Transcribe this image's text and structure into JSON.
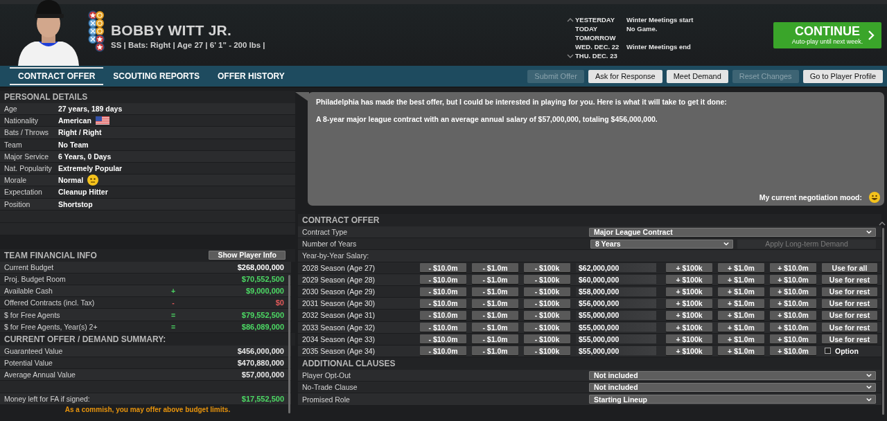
{
  "player": {
    "name": "BOBBY WITT JR.",
    "info": "SS | Bats: Right | Age 27 | 6' 1\"  - 200 lbs |"
  },
  "calendar": [
    {
      "day": "YESTERDAY",
      "event": "Winter Meetings start"
    },
    {
      "day": "TODAY",
      "event": "No Game."
    },
    {
      "day": "TOMORROW"
    },
    {
      "day": "WED. DEC. 22",
      "event": "Winter Meetings end"
    },
    {
      "day": "THU. DEC. 23"
    }
  ],
  "continue_button": {
    "label": "CONTINUE",
    "sublabel": "Auto-play until next week."
  },
  "tabs": [
    {
      "label": "CONTRACT OFFER",
      "selected": true
    },
    {
      "label": "SCOUTING REPORTS",
      "selected": false
    },
    {
      "label": "OFFER HISTORY",
      "selected": false
    }
  ],
  "actions": [
    {
      "label": "Submit Offer",
      "disabled": true
    },
    {
      "label": "Ask for Response",
      "disabled": false
    },
    {
      "label": "Meet Demand",
      "disabled": false
    },
    {
      "label": "Reset Changes",
      "disabled": true
    },
    {
      "label": "Go to Player Profile",
      "disabled": false
    }
  ],
  "personal_details": {
    "title": "PERSONAL DETAILS",
    "rows": [
      {
        "label": "Age",
        "value": "27 years, 189 days",
        "kind": "text"
      },
      {
        "label": "Nationality",
        "value": "American",
        "kind": "flag"
      },
      {
        "label": "Bats / Throws",
        "value": "Right / Right",
        "kind": "text"
      },
      {
        "label": "Team",
        "value": "No Team",
        "kind": "text"
      },
      {
        "label": "Major Service",
        "value": "6 Years, 0 Days",
        "kind": "text"
      },
      {
        "label": "Nat. Popularity",
        "value": "Extremely Popular",
        "kind": "text"
      },
      {
        "label": "Morale",
        "value": "Normal",
        "kind": "face"
      },
      {
        "label": "Expectation",
        "value": "Cleanup Hitter",
        "kind": "text"
      },
      {
        "label": "Position",
        "value": "Shortstop",
        "kind": "text"
      }
    ]
  },
  "team_financial_info": {
    "title": "TEAM FINANCIAL INFO",
    "button": "Show Player Info",
    "rows": [
      {
        "label": "Current Budget",
        "sign": "",
        "value": "$268,000,000",
        "color": "#ffffff"
      },
      {
        "label": "Proj. Budget Room",
        "sign": "",
        "value": "$70,552,500",
        "color": "#4cd964"
      },
      {
        "label": "Available Cash",
        "sign": "+",
        "value": "$9,000,000",
        "color": "#4cd964"
      },
      {
        "label": "Offered Contracts (incl. Tax)",
        "sign": "-",
        "value": "$0",
        "color": "#e05a5a"
      },
      {
        "label": "$ for Free Agents",
        "sign": "=",
        "value": "$79,552,500",
        "color": "#4cd964"
      },
      {
        "label": "$ for Free Agents, Year(s) 2+",
        "sign": "=",
        "value": "$86,089,000",
        "color": "#4cd964"
      }
    ]
  },
  "summary": {
    "title": "CURRENT OFFER / DEMAND SUMMARY:",
    "rows": [
      {
        "label": "Guaranteed Value",
        "value": "$456,000,000"
      },
      {
        "label": "Potential Value",
        "value": "$470,880,000"
      },
      {
        "label": "Average Annual Value",
        "value": "$57,000,000"
      }
    ],
    "money_left": {
      "label": "Money left for FA if signed:",
      "value": "$17,552,500"
    },
    "note": "As a commish, you may offer above budget limits."
  },
  "message": {
    "lines": [
      "Philadelphia has made the best offer, but I could be interested in playing for you. Here is what it will take to get it done:",
      "A 8-year major league contract with an average annual salary of $57,000,000, totaling $456,000,000."
    ],
    "mood_label": "My current negotiation mood:"
  },
  "contract_offer": {
    "title": "CONTRACT OFFER",
    "contract_type": {
      "label": "Contract Type",
      "value": "Major League Contract"
    },
    "years": {
      "label": "Number of Years",
      "value": "8 Years"
    },
    "apply_button": {
      "label": "Apply Long-term Demand",
      "disabled": true
    },
    "salary_label": "Year-by-Year Salary:",
    "seasons": [
      {
        "season": "2028 Season (Age 27)",
        "minus": [
          "- $10.0m",
          "- $1.0m",
          "- $100k"
        ],
        "amount": "$62,000,000",
        "plus": [
          "+ $100k",
          "+ $1.0m",
          "+ $10.0m"
        ],
        "action": {
          "kind": "button",
          "label": "Use for all"
        }
      },
      {
        "season": "2029 Season (Age 28)",
        "minus": [
          "- $10.0m",
          "- $1.0m",
          "- $100k"
        ],
        "amount": "$60,000,000",
        "plus": [
          "+ $100k",
          "+ $1.0m",
          "+ $10.0m"
        ],
        "action": {
          "kind": "button",
          "label": "Use for rest"
        }
      },
      {
        "season": "2030 Season (Age 29)",
        "minus": [
          "- $10.0m",
          "- $1.0m",
          "- $100k"
        ],
        "amount": "$58,000,000",
        "plus": [
          "+ $100k",
          "+ $1.0m",
          "+ $10.0m"
        ],
        "action": {
          "kind": "button",
          "label": "Use for rest"
        }
      },
      {
        "season": "2031 Season (Age 30)",
        "minus": [
          "- $10.0m",
          "- $1.0m",
          "- $100k"
        ],
        "amount": "$56,000,000",
        "plus": [
          "+ $100k",
          "+ $1.0m",
          "+ $10.0m"
        ],
        "action": {
          "kind": "button",
          "label": "Use for rest"
        }
      },
      {
        "season": "2032 Season (Age 31)",
        "minus": [
          "- $10.0m",
          "- $1.0m",
          "- $100k"
        ],
        "amount": "$55,000,000",
        "plus": [
          "+ $100k",
          "+ $1.0m",
          "+ $10.0m"
        ],
        "action": {
          "kind": "button",
          "label": "Use for rest"
        }
      },
      {
        "season": "2033 Season (Age 32)",
        "minus": [
          "- $10.0m",
          "- $1.0m",
          "- $100k"
        ],
        "amount": "$55,000,000",
        "plus": [
          "+ $100k",
          "+ $1.0m",
          "+ $10.0m"
        ],
        "action": {
          "kind": "button",
          "label": "Use for rest"
        }
      },
      {
        "season": "2034 Season (Age 33)",
        "minus": [
          "- $10.0m",
          "- $1.0m",
          "- $100k"
        ],
        "amount": "$55,000,000",
        "plus": [
          "+ $100k",
          "+ $1.0m",
          "+ $10.0m"
        ],
        "action": {
          "kind": "button",
          "label": "Use for rest"
        }
      },
      {
        "season": "2035 Season (Age 34)",
        "minus": [
          "- $10.0m",
          "- $1.0m",
          "- $100k"
        ],
        "amount": "$55,000,000",
        "plus": [
          "+ $100k",
          "+ $1.0m",
          "+ $10.0m"
        ],
        "action": {
          "kind": "checkbox",
          "label": "Option",
          "checked": false
        }
      }
    ]
  },
  "additional_clauses": {
    "title": "ADDITIONAL CLAUSES",
    "rows": [
      {
        "label": "Player Opt-Out",
        "value": "Not included"
      },
      {
        "label": "No-Trade Clause",
        "value": "Not included"
      },
      {
        "label": "Promised Role",
        "value": "Starting Lineup"
      }
    ]
  }
}
